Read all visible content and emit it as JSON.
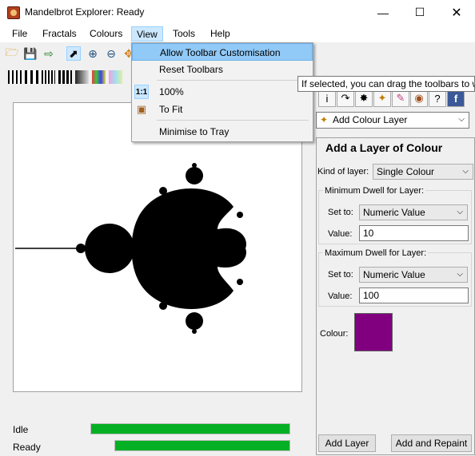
{
  "window": {
    "title": "Mandelbrot Explorer: Ready"
  },
  "menu": [
    "File",
    "Fractals",
    "Colours",
    "View",
    "Tools",
    "Help"
  ],
  "view_menu": {
    "items": [
      "Allow Toolbar Customisation",
      "Reset Toolbars",
      "100%",
      "To Fit",
      "Minimise to Tray"
    ],
    "icon_100": "1:1"
  },
  "tooltip": "If selected, you can drag the toolbars to w",
  "right_panel": {
    "layer_combo": "Add Colour Layer",
    "title": "Add a Layer of Colour",
    "kind_label": "Kind of layer:",
    "kind_value": "Single Colour",
    "min_group": "Minimum Dwell for Layer:",
    "max_group": "Maximum Dwell for Layer:",
    "set_to_label": "Set to:",
    "set_to_value": "Numeric Value",
    "value_label": "Value:",
    "min_value": "10",
    "max_value": "100",
    "colour_label": "Colour:",
    "colour_swatch": "#800080",
    "add_layer_btn": "Add Layer",
    "add_repaint_btn": "Add and Repaint"
  },
  "status": {
    "idle": "Idle",
    "ready": "Ready",
    "idle_progress": 1.0,
    "ready_progress": 1.0
  },
  "colors": {
    "progress": "#06b025",
    "menu_highlight": "#91c9f7"
  }
}
